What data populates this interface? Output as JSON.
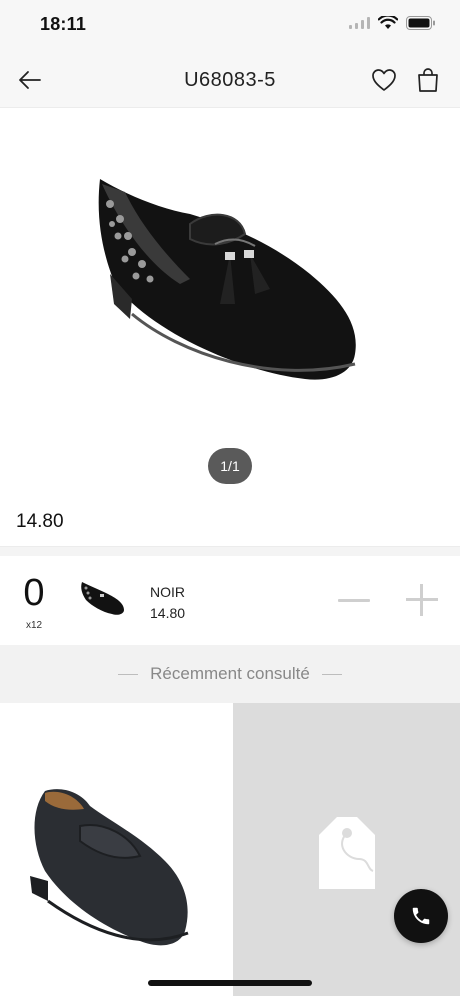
{
  "status_bar": {
    "time": "18:11"
  },
  "nav": {
    "title": "U68083-5"
  },
  "gallery": {
    "pager": "1/1"
  },
  "product": {
    "price": "14.80"
  },
  "variant": {
    "quantity": "0",
    "pack": "x12",
    "color": "NOIR",
    "price": "14.80"
  },
  "recent": {
    "title": "Récemment consulté"
  },
  "colors": {
    "background": "#ffffff",
    "header_bg": "#f7f7f7",
    "pager_bg": "#5a5a5a",
    "stepper": "#cfcfcf",
    "call_button": "#111111"
  },
  "icons": [
    "back-arrow-icon",
    "heart-icon",
    "shopping-bag-icon",
    "wifi-icon",
    "battery-icon",
    "signal-icon",
    "minus-icon",
    "plus-icon",
    "price-tag-placeholder-icon",
    "phone-icon"
  ]
}
